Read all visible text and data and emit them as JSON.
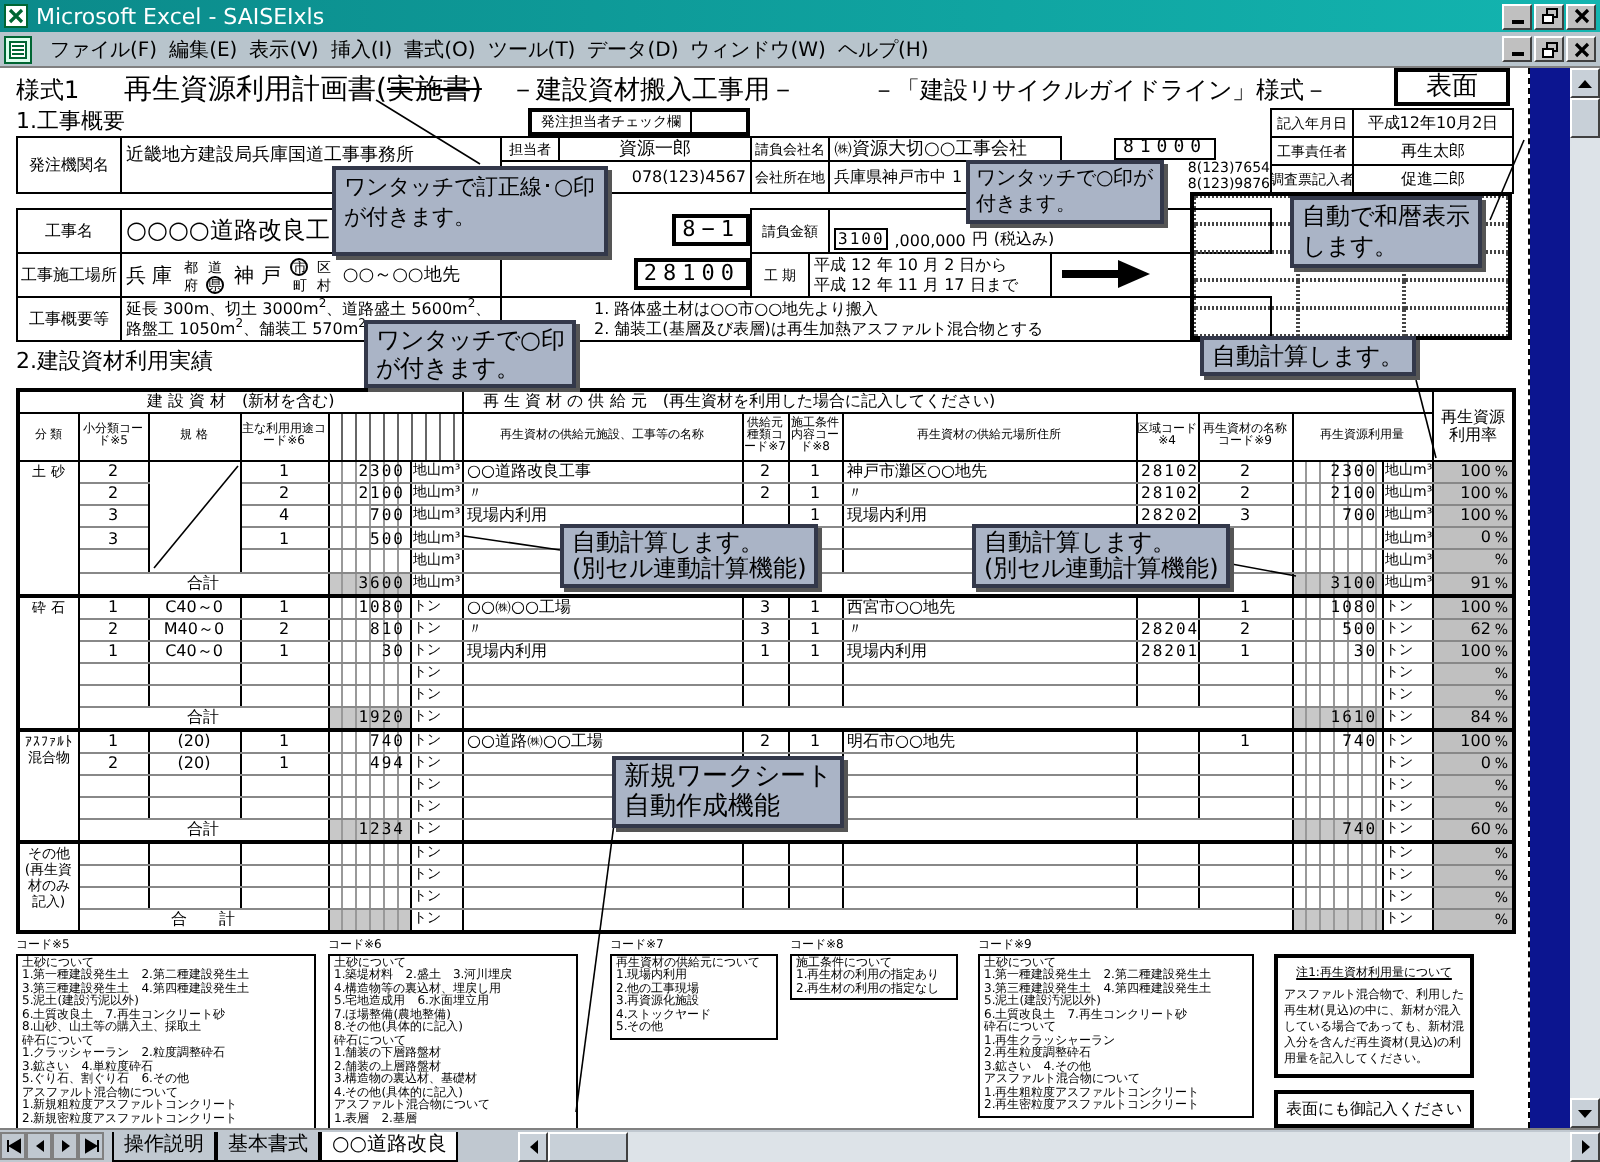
{
  "window": {
    "title": "Microsoft Excel - SAISEIxls"
  },
  "menu": [
    "ファイル(F)",
    "編集(E)",
    "表示(V)",
    "挿入(I)",
    "書式(O)",
    "ツール(T)",
    "データ(D)",
    "ウィンドウ(W)",
    "ヘルプ(H)"
  ],
  "sheet": {
    "form_label": "様式1",
    "title": "再生資源利用計画書(",
    "title_struck": "実施書)",
    "subtitle": "－建設資材搬入工事用－",
    "guideline": "－「建設リサイクルガイドライン」様式－",
    "face_label": "表面",
    "section1": "1.工事概要",
    "orderer": {
      "label": "発注機関名",
      "value": "近畿地方建設局兵庫国道工事事務所"
    },
    "check": {
      "label": "発注担当者チェック欄"
    },
    "person": {
      "label": "担当者",
      "value": "資源一郎",
      "phone": "078(123)4567"
    },
    "contractor": {
      "label": "請負会社名",
      "value": "㈱資源大切○○工事会社",
      "addr_label": "会社所在地",
      "addr": "兵庫県神戸市中",
      "addr2": "1",
      "code": "81000",
      "phones": [
        "8(123)7654",
        "8(123)9876"
      ]
    },
    "record": [
      {
        "label": "記入年月日",
        "value": "平成12年10月2日"
      },
      {
        "label": "工事責任者",
        "value": "再生太郎"
      },
      {
        "label": "調査票記入者",
        "value": "促進二郎"
      }
    ],
    "project": {
      "label": "工事名",
      "value": "○○○○道路改良工",
      "code": "8−1"
    },
    "amount": {
      "label": "請負金額",
      "value": "3100",
      ",rest": ",000,000",
      "unit": "円",
      "note": "(税込み)"
    },
    "site": {
      "label": "工事施工場所",
      "pref": "兵 庫",
      "pref_units": [
        {
          "label": "都",
          "selected": false
        },
        {
          "label": "道",
          "selected": false
        },
        {
          "label": "府",
          "selected": false
        },
        {
          "label": "県",
          "selected": true
        }
      ],
      "city": "神 戸",
      "city_units": [
        {
          "label": "市",
          "selected": true
        },
        {
          "label": "区",
          "selected": false
        },
        {
          "label": "町",
          "selected": false
        },
        {
          "label": "村",
          "selected": false
        }
      ],
      "place": "○○～○○地先",
      "code": "28100"
    },
    "period": {
      "label": "工 期",
      "lines": [
        "平成 12 年 10 月 2 日から",
        "平成 12 年 11 月 17 日まで"
      ]
    },
    "summary": {
      "label": "工事概要等",
      "lines": [
        "延長 300m、切土 3000m$^{2}$、道路盛土 5600m$^{2}$、",
        "路盤工 1050m$^{2}$、舗装工 570m$^{2}$"
      ]
    },
    "notes": [
      "1. 路体盛土材は○○市○○地先より搬入",
      "2. 舗装工(基層及び表層)は再生加熱アスファルト混合物とする"
    ],
    "section2": "2.建設資材利用実績",
    "table": {
      "group_headers": [
        "建 設 資 材　(新材を含む)",
        "再 生 資 材 の 供 給 元　(再生資材を利用した場合に記入してください)",
        "再生資源利用率"
      ],
      "columns": [
        "分 類",
        "小分類コード※5",
        "規 格",
        "主な利用用途コード※6",
        "再生資材の供給元施設、工事等の名称",
        "供給元種類コード※7",
        "施工条件内容コード※8",
        "再生資材の供給元場所住所",
        "区域コード※4",
        "再生資材の名称コード※9",
        "再生資源利用量"
      ],
      "groups": [
        {
          "label": "土 砂",
          "slash": true,
          "rows": [
            {
              "sub": "2",
              "use": "1",
              "qty": "2300",
              "unit": "地山m³",
              "source": "○○道路改良工事",
              "src_type": "2",
              "cond": "1",
              "addr": "神戸市灘区○○地先",
              "area": "28102",
              "mat": "2",
              "used": "2300",
              "unit2": "地山m³",
              "rate": "100",
              "pct": "%"
            },
            {
              "sub": "2",
              "use": "2",
              "qty": "2100",
              "unit": "地山m³",
              "source": "〃",
              "src_type": "2",
              "cond": "1",
              "addr": "〃",
              "area": "28102",
              "mat": "2",
              "used": "2100",
              "unit2": "地山m³",
              "rate": "100",
              "pct": "%"
            },
            {
              "sub": "3",
              "use": "4",
              "qty": "700",
              "unit": "地山m³",
              "source": "現場内利用",
              "cond": "1",
              "addr": "現場内利用",
              "area": "28202",
              "mat": "3",
              "used": "700",
              "unit2": "地山m³",
              "rate": "100",
              "pct": "%"
            },
            {
              "sub": "3",
              "use": "1",
              "qty": "500",
              "unit": "地山m³",
              "unit2": "地山m³",
              "rate": "0",
              "pct": "%"
            },
            {
              "unit": "地山m³",
              "unit2": "地山m³",
              "pct": "%"
            }
          ],
          "total": {
            "label": "合計",
            "qty": "3600",
            "unit": "地山m³",
            "used": "3100",
            "unit2": "地山m³",
            "rate": "91",
            "pct": "%"
          }
        },
        {
          "label": "砕 石",
          "slash": false,
          "rows": [
            {
              "sub": "1",
              "spec": "C40～0",
              "use": "1",
              "qty": "1080",
              "unit": "トン",
              "source": "○○㈱○○工場",
              "src_type": "3",
              "cond": "1",
              "addr": "西宮市○○地先",
              "mat": "1",
              "used": "1080",
              "unit2": "トン",
              "rate": "100",
              "pct": "%"
            },
            {
              "sub": "2",
              "spec": "M40～0",
              "use": "2",
              "qty": "810",
              "unit": "トン",
              "source": "〃",
              "src_type": "3",
              "cond": "1",
              "addr": "〃",
              "area": "28204",
              "mat": "2",
              "used": "500",
              "unit2": "トン",
              "rate": "62",
              "pct": "%"
            },
            {
              "sub": "1",
              "spec": "C40～0",
              "use": "1",
              "qty": "30",
              "unit": "トン",
              "source": "現場内利用",
              "src_type": "1",
              "cond": "1",
              "addr": "現場内利用",
              "area": "28201",
              "mat": "1",
              "used": "30",
              "unit2": "トン",
              "rate": "100",
              "pct": "%"
            },
            {
              "unit": "トン",
              "unit2": "トン",
              "pct": "%"
            },
            {
              "unit": "トン",
              "unit2": "トン",
              "pct": "%"
            }
          ],
          "total": {
            "label": "合計",
            "qty": "1920",
            "unit": "トン",
            "used": "1610",
            "unit2": "トン",
            "rate": "84",
            "pct": "%"
          }
        },
        {
          "label": "ｱｽﾌｧﾙﾄ混合物",
          "slash": false,
          "rows": [
            {
              "sub": "1",
              "spec": "(20)",
              "use": "1",
              "qty": "740",
              "unit": "トン",
              "source": "○○道路㈱○○工場",
              "src_type": "2",
              "cond": "1",
              "addr": "明石市○○地先",
              "mat": "1",
              "used": "740",
              "unit2": "トン",
              "rate": "100",
              "pct": "%"
            },
            {
              "sub": "2",
              "spec": "(20)",
              "use": "1",
              "qty": "494",
              "unit": "トン",
              "unit2": "トン",
              "rate": "0",
              "pct": "%"
            },
            {
              "unit": "トン",
              "unit2": "トン",
              "pct": "%"
            },
            {
              "unit": "トン",
              "unit2": "トン",
              "pct": "%"
            }
          ],
          "total": {
            "label": "合計",
            "qty": "1234",
            "unit": "トン",
            "used": "740",
            "unit2": "トン",
            "rate": "60",
            "pct": "%"
          }
        },
        {
          "label": "その他(再生資材のみ記入)",
          "slash": false,
          "rows": [
            {
              "unit": "トン",
              "unit2": "トン",
              "pct": "%"
            },
            {
              "unit": "トン",
              "unit2": "トン",
              "pct": "%"
            },
            {
              "unit": "トン",
              "unit2": "トン",
              "pct": "%"
            }
          ],
          "total": {
            "label": "合　　計",
            "unit": "トン",
            "unit2": "トン",
            "pct": "%"
          }
        }
      ]
    },
    "code_boxes": [
      {
        "label": "コード※5",
        "lines": [
          "土砂について",
          "1.第一種建設発生土　2.第二種建設発生土",
          "3.第三種建設発生土　4.第四種建設発生土",
          "5.泥土(建設汚泥以外)",
          "6.土質改良土　7.再生コンクリート砂",
          "8.山砂、山土等の購入土、採取土",
          "砕石について",
          "1.クラッシャーラン　2.粒度調整砕石",
          "3.鉱さい　4.単粒度砕石",
          "5.ぐり石、割ぐり石　6.その他",
          "アスファルト混合物について",
          "1.新規粗粒度アスファルトコンクリート",
          "2.新規密粒度アスファルトコンクリート"
        ]
      },
      {
        "label": "コード※6",
        "lines": [
          "土砂について",
          "1.築堤材料　2.盛土　3.河川埋戻",
          "4.構造物等の裏込材、埋戻し用",
          "5.宅地造成用　6.水面埋立用",
          "7.ほ場整備(農地整備)",
          "8.その他(具体的に記入)",
          "砕石について",
          "1.舗装の下層路盤材",
          "2.舗装の上層路盤材",
          "3.構造物の裏込材、基礎材",
          "4.その他(具体的に記入)",
          "アスファルト混合物について",
          "1.表層　2.基層"
        ]
      },
      {
        "label": "コード※7",
        "lines": [
          "再生資材の供給元について",
          "1.現場内利用",
          "2.他の工事現場",
          "3.再資源化施設",
          "4.ストックヤード",
          "5.その他"
        ]
      },
      {
        "label": "コード※8",
        "lines": [
          "施工条件について",
          "1.再生材の利用の指定あり",
          "2.再生材の利用の指定なし"
        ]
      },
      {
        "label": "コード※9",
        "lines": [
          "土砂について",
          "1.第一種建設発生土　2.第二種建設発生土",
          "3.第三種建設発生土　4.第四種建設発生土",
          "5.泥土(建設汚泥以外)",
          "6.土質改良土　7.再生コンクリート砂",
          "砕石について",
          "1.再生クラッシャーラン",
          "2.再生粒度調整砕石",
          "3.鉱さい　4.その他",
          "アスファルト混合物について",
          "1.再生粗粒度アスファルトコンクリート",
          "2.再生密粒度アスファルトコンクリート"
        ]
      }
    ],
    "note_box": {
      "title": "注1:再生資材利用量について",
      "text": "アスファルト混合物で、利用した再生材(見込)の中に、新材が混入している場合であっても、新材混入分を含んだ再生資材(見込)の利用量を記入してください。"
    },
    "reminder": "表面にも御記入ください"
  },
  "callouts": [
    {
      "lines": [
        "ワンタッチで訂正線･○印",
        "が付きます。"
      ]
    },
    {
      "lines": [
        "ワンタッチで○印",
        "が付きます。"
      ]
    },
    {
      "lines": [
        "ワンタッチで○印が",
        "付きます。"
      ]
    },
    {
      "lines": [
        "自動で和暦表示",
        "します。"
      ]
    },
    {
      "lines": [
        "自動計算します。"
      ]
    },
    {
      "lines": [
        "自動計算します。",
        "(別セル連動計算機能)"
      ]
    },
    {
      "lines": [
        "自動計算します。",
        "(別セル連動計算機能)"
      ]
    },
    {
      "lines": [
        "新規ワークシート",
        "自動作成機能"
      ]
    }
  ],
  "sheet_tabs": [
    {
      "label": "操作説明",
      "selected": false
    },
    {
      "label": "基本書式",
      "selected": false
    },
    {
      "label": "○○道路改良",
      "selected": true
    }
  ]
}
